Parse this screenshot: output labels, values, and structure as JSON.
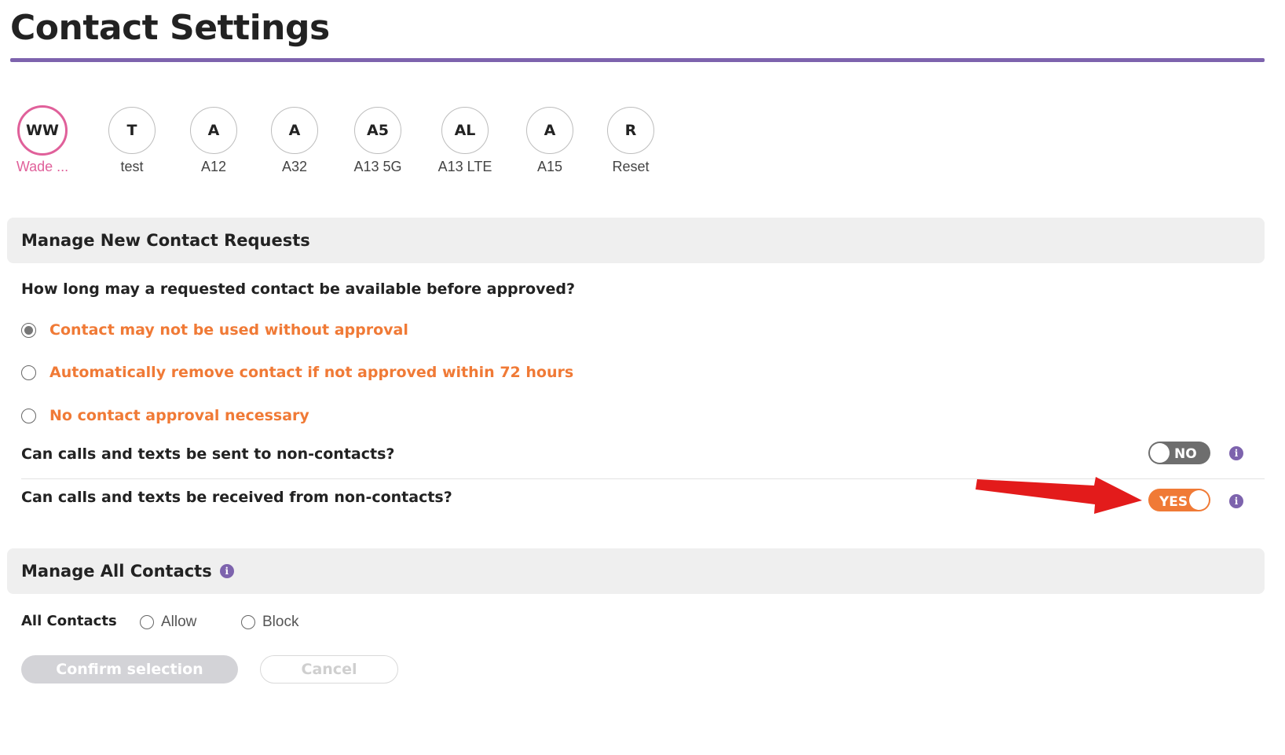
{
  "page": {
    "title": "Contact Settings"
  },
  "contacts": [
    {
      "initials": "WW",
      "label": "Wade ...",
      "active": true
    },
    {
      "initials": "T",
      "label": "test"
    },
    {
      "initials": "A",
      "label": "A12"
    },
    {
      "initials": "A",
      "label": "A32"
    },
    {
      "initials": "A5",
      "label": "A13 5G"
    },
    {
      "initials": "AL",
      "label": "A13 LTE"
    },
    {
      "initials": "A",
      "label": "A15"
    },
    {
      "initials": "R",
      "label": "Reset"
    }
  ],
  "new_requests": {
    "header": "Manage New Contact Requests",
    "question": "How long may a requested contact be available before approved?",
    "options": [
      {
        "label": "Contact may not be used without approval",
        "selected": true
      },
      {
        "label": "Automatically remove contact if not approved within 72 hours",
        "selected": false
      },
      {
        "label": "No contact approval necessary",
        "selected": false
      }
    ],
    "send_question": "Can calls and texts be sent to non-contacts?",
    "send_toggle": "NO",
    "receive_question": "Can calls and texts be received from non-contacts?",
    "receive_toggle": "YES",
    "info_glyph": "i"
  },
  "all_contacts": {
    "header": "Manage All Contacts",
    "label": "All Contacts",
    "allow_label": "Allow",
    "block_label": "Block"
  },
  "actions": {
    "confirm_label": "Confirm selection",
    "cancel_label": "Cancel"
  },
  "colors": {
    "accent_purple": "#7d63ad",
    "accent_orange": "#f07a36",
    "active_pink": "#e0609a",
    "annotation_arrow": "#e31b1b"
  },
  "icons": {
    "info": "info-icon",
    "annotation": "red-arrow-icon"
  }
}
